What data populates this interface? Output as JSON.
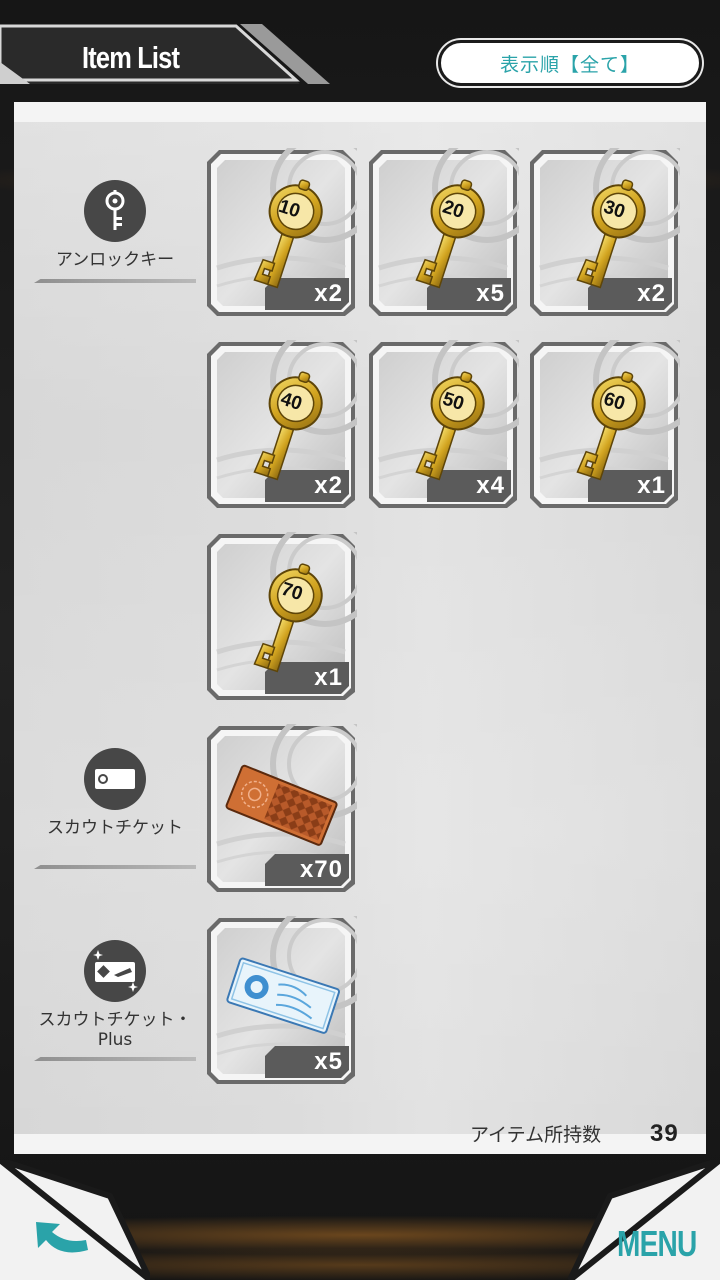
{
  "header": {
    "title": "Item List",
    "sort_button_label": "表示順【全て】"
  },
  "categories": [
    {
      "label": "アンロックキー",
      "icon": "key-icon"
    },
    {
      "label": "スカウトチケット",
      "icon": "ticket-icon"
    },
    {
      "label": "スカウトチケット・Plus",
      "icon": "ticket-plus-icon"
    }
  ],
  "items": [
    {
      "kind": "key",
      "number": "10",
      "quantity": "x2"
    },
    {
      "kind": "key",
      "number": "20",
      "quantity": "x5"
    },
    {
      "kind": "key",
      "number": "30",
      "quantity": "x2"
    },
    {
      "kind": "key",
      "number": "40",
      "quantity": "x2"
    },
    {
      "kind": "key",
      "number": "50",
      "quantity": "x4"
    },
    {
      "kind": "key",
      "number": "60",
      "quantity": "x1"
    },
    {
      "kind": "key",
      "number": "70",
      "quantity": "x1"
    },
    {
      "kind": "scout-ticket",
      "quantity": "x70"
    },
    {
      "kind": "scout-ticket-plus",
      "quantity": "x5"
    }
  ],
  "footer": {
    "item_count_label": "アイテム所持数",
    "item_count_value": "39",
    "back_icon": "back-arrow-icon",
    "menu_label": "MENU"
  },
  "colors": {
    "accent": "#2aa3a9",
    "gold": "#d4a82a",
    "panel": "#dcdcdc"
  }
}
